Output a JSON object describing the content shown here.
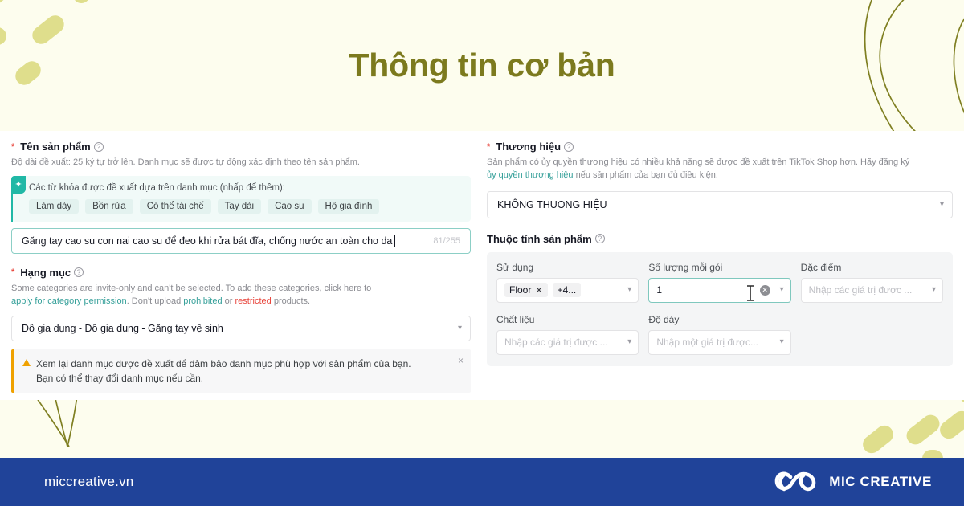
{
  "banner": {
    "title": "Thông tin cơ bản",
    "title_color": "#7C7A1E",
    "background_color": "#FDFDEE"
  },
  "product_name": {
    "label": "Tên sản phẩm",
    "required_marker": "*",
    "help_icon": "question-circle-icon",
    "description": "Độ dài đề xuất: 25 ký tự trở lên. Danh mục sẽ được tự động xác định theo tên sản phẩm.",
    "ai_box": {
      "icon": "sparkle-icon",
      "prompt": "Các từ khóa được đề xuất dựa trên danh mục (nhấp để thêm):",
      "keywords": [
        "Làm dày",
        "Bồn rửa",
        "Có thể tái chế",
        "Tay dài",
        "Cao su",
        "Hộ gia đình"
      ],
      "accent_color": "#21B8A6"
    },
    "input_value": "Găng tay cao su con nai cao su để đeo khi rửa bát đĩa, chống nước an toàn cho da",
    "counter": "81/255"
  },
  "category": {
    "label": "Hạng mục",
    "required_marker": "*",
    "help_icon": "question-circle-icon",
    "desc_line1_a": "Some categories are invite-only and can't be selected. To add these categories, click here to",
    "desc_link1": "apply for category permission",
    "desc_mid": ". Don't upload ",
    "desc_link2": "prohibited",
    "desc_or": " or ",
    "desc_link3": "restricted",
    "desc_end": " products.",
    "selected": "Đồ gia dụng - Đồ gia dụng - Găng tay vệ sinh",
    "chevron": "chevron-down-icon",
    "warning": {
      "icon": "warning-triangle-icon",
      "line1": "Xem lại danh mục được đề xuất để đảm bảo danh mục phù hợp với sản phẩm của bạn.",
      "line2": "Bạn có thể thay đổi danh mục nếu cần.",
      "close": "×",
      "accent_color": "#EFA100"
    }
  },
  "brand": {
    "label": "Thương hiệu",
    "required_marker": "*",
    "help_icon": "question-circle-icon",
    "desc_a": "Sản phẩm có ủy quyền thương hiệu có nhiều khả năng sẽ được đề xuất trên TikTok Shop hơn. Hãy đăng ký",
    "desc_link": "ủy quyền thương hiệu",
    "desc_b": " nếu sản phẩm của bạn đủ điều kiện.",
    "selected": "KHÔNG THUONG HIỆU",
    "chevron": "chevron-down-icon"
  },
  "attributes": {
    "title": "Thuộc tính sản phẩm",
    "help_icon": "question-circle-icon",
    "fields": [
      {
        "label": "Sử dụng",
        "type": "tags",
        "tags": [
          "Floor"
        ],
        "overflow": "+4...",
        "placeholder": ""
      },
      {
        "label": "Số lượng mỗi gói",
        "type": "value",
        "value": "1",
        "focused": true,
        "clear_icon": "clear-circle-icon"
      },
      {
        "label": "Đặc điểm",
        "type": "placeholder",
        "placeholder": "Nhập các giá trị được ..."
      },
      {
        "label": "Chất liệu",
        "type": "placeholder",
        "placeholder": "Nhập các giá trị được ..."
      },
      {
        "label": "Độ dày",
        "type": "placeholder",
        "placeholder": "Nhập một giá trị được..."
      }
    ]
  },
  "footer": {
    "site": "miccreative.vn",
    "brand_name": "MIC CREATIVE",
    "logo_icon": "infinity-loop-icon",
    "background_color": "#204399"
  }
}
